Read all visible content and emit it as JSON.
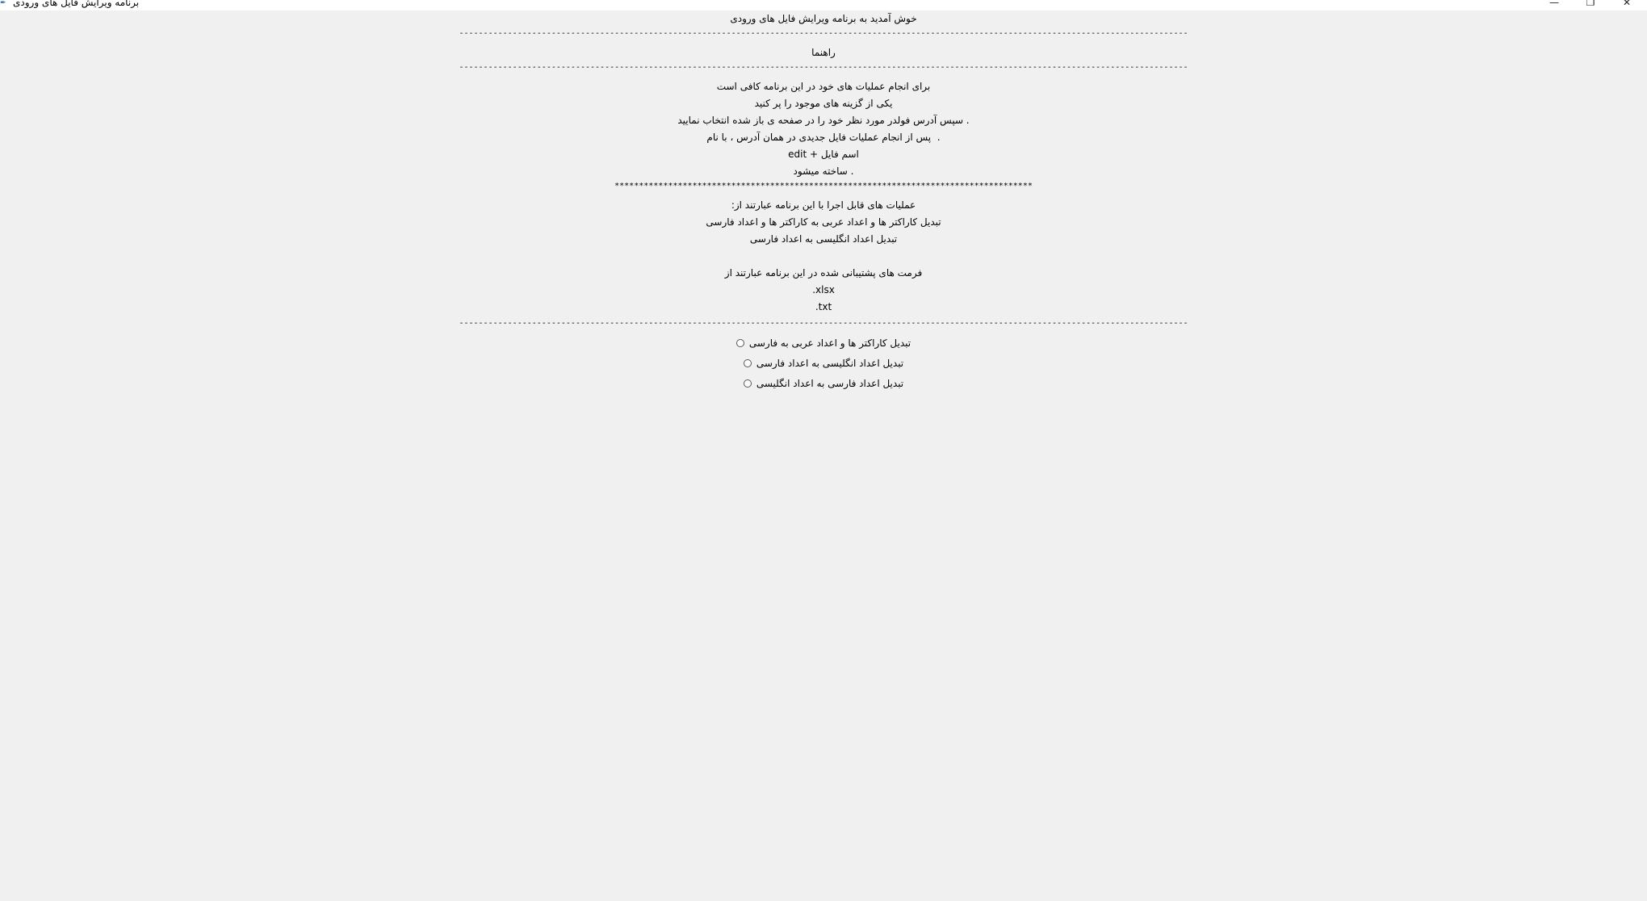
{
  "window": {
    "title": "برنامه ویرایش فایل های ورودی",
    "minimize_glyph": "—",
    "maximize_glyph": "❐",
    "close_glyph": "✕"
  },
  "content": {
    "welcome": "خوش آمدید به برنامه ویرایش فایل های ورودی",
    "separator": "------------------------------------------------------------------------------------------------------------------------------------------------------",
    "help_title": "راهنما",
    "help_lines": [
      "برای انجام عملیات های خود در این برنامه کافی است",
      "یکی از گزینه های موجود را پر کنید",
      ". سپس آدرس فولدر مورد نظر خود را در صفحه ی باز شده انتخاب نمایید",
      ".  پس از انجام عملیات فایل جدیدی در همان آدرس ، با نام",
      "edit + اسم فایل",
      ". ساخته میشود"
    ],
    "stars": "**************************************************************************************",
    "operations_title": "عملیات های قابل اجرا با این برنامه عبارتند از:",
    "operations": [
      "تبدیل کاراکتر ها و اعداد عربی به کاراکتر ها و اعداد فارسی",
      "تبدیل اعداد انگلیسی به اعداد فارسی"
    ],
    "formats_title": "فرمت های پشتیبانی شده در این برنامه عبارتند از",
    "formats": [
      ".xlsx",
      ".txt"
    ]
  },
  "options": [
    {
      "label": "تبدیل کاراکتر ها و اعداد عربی به فارسی",
      "selected": false
    },
    {
      "label": "تبدیل اعداد انگلیسی به اعداد فارسی",
      "selected": false
    },
    {
      "label": "تبدیل اعداد فارسی به اعداد انگلیسی",
      "selected": false
    }
  ]
}
